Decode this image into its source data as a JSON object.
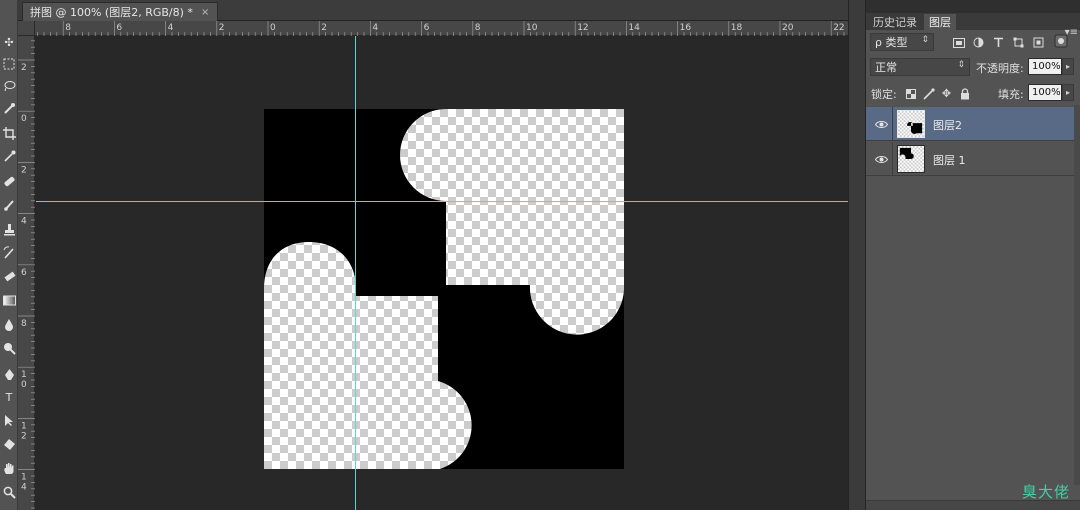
{
  "document_tab": {
    "title": "拼图 @ 100% (图层2, RGB/8) *",
    "close": "×"
  },
  "ruler_top_labels": [
    "8",
    "6",
    "4",
    "2",
    "0",
    "2",
    "4",
    "6",
    "8",
    "10",
    "12",
    "14",
    "16",
    "18",
    "20",
    "22"
  ],
  "ruler_left_labels": [
    "2",
    "0",
    "2",
    "4",
    "6",
    "8",
    "1\n0",
    "1\n2",
    "1\n4"
  ],
  "toolbar": {
    "tools": [
      "move-tool",
      "marquee-tool",
      "lasso-tool",
      "quick-select-tool",
      "crop-tool",
      "eyedropper-tool",
      "healing-brush-tool",
      "brush-tool",
      "clone-stamp-tool",
      "history-brush-tool",
      "eraser-tool",
      "gradient-tool",
      "blur-tool",
      "dodge-tool",
      "pen-tool",
      "type-tool",
      "path-selection-tool",
      "shape-tool",
      "hand-tool",
      "zoom-tool"
    ],
    "type_glyph": "T"
  },
  "panel": {
    "tabs": [
      "历史记录",
      "图层"
    ],
    "active_tab": "图层",
    "menu_icon": "▾≡",
    "filter_kind": "ρ 类型",
    "blend_mode": "正常",
    "opacity_label": "不透明度:",
    "opacity_value": "100%",
    "lock_label": "锁定:",
    "fill_label": "填充:",
    "fill_value": "100%",
    "layers": [
      {
        "name": "图层2",
        "selected": true
      },
      {
        "name": "图层 1",
        "selected": false
      }
    ]
  },
  "watermark": "臭大佬",
  "colors": {
    "guide": "#54d7d7",
    "selected_layer": "#596a86",
    "watermark": "#3fd0a6"
  }
}
